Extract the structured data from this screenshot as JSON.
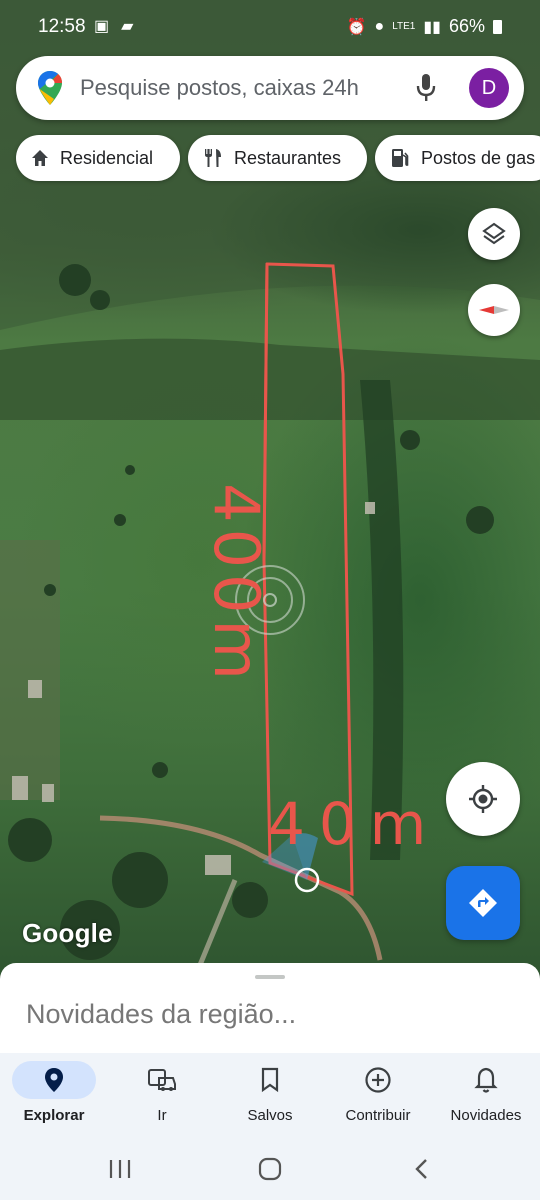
{
  "status": {
    "time": "12:58",
    "network_label": "LTE1",
    "battery": "66%"
  },
  "search": {
    "placeholder": "Pesquise postos, caixas 24h",
    "avatar_letter": "D"
  },
  "chips": [
    {
      "label": "Residencial",
      "icon": "home-icon"
    },
    {
      "label": "Restaurantes",
      "icon": "fork-knife-icon"
    },
    {
      "label": "Postos de gas",
      "icon": "gas-station-icon"
    }
  ],
  "map": {
    "annotation_length": "400m",
    "annotation_width": "40m",
    "attribution": "Google"
  },
  "sheet": {
    "title": "Novidades da região..."
  },
  "nav": {
    "items": [
      {
        "label": "Explorar",
        "icon": "explore-pin-icon",
        "active": true
      },
      {
        "label": "Ir",
        "icon": "commute-icon",
        "active": false
      },
      {
        "label": "Salvos",
        "icon": "bookmark-icon",
        "active": false
      },
      {
        "label": "Contribuir",
        "icon": "add-circle-icon",
        "active": false
      },
      {
        "label": "Novidades",
        "icon": "bell-icon",
        "active": false
      }
    ]
  },
  "colors": {
    "accent": "#1a73e8",
    "avatar": "#7b1fa2",
    "annotation": "#e8564b"
  }
}
